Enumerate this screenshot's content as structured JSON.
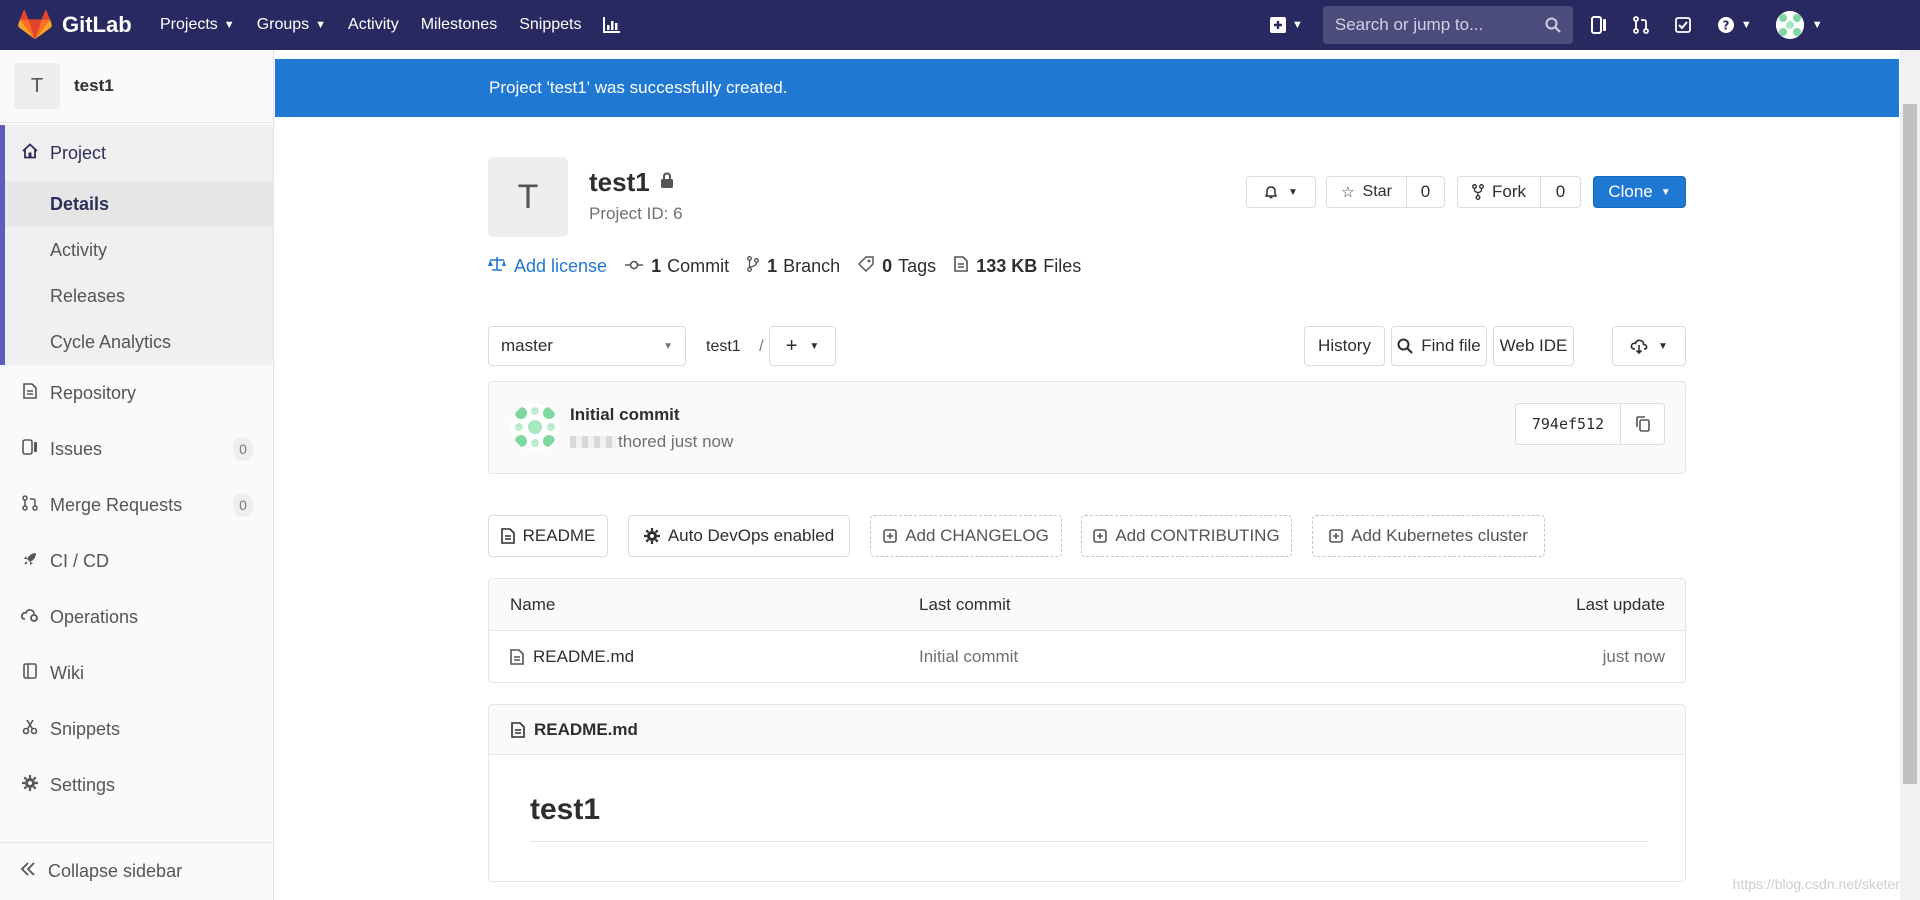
{
  "navbar": {
    "brand": "GitLab",
    "items": [
      {
        "label": "Projects",
        "has_caret": true
      },
      {
        "label": "Groups",
        "has_caret": true
      },
      {
        "label": "Activity",
        "has_caret": false
      },
      {
        "label": "Milestones",
        "has_caret": false
      },
      {
        "label": "Snippets",
        "has_caret": false
      }
    ],
    "search_placeholder": "Search or jump to...",
    "bg_color": "#292961"
  },
  "sidebar": {
    "project_initial": "T",
    "project_name": "test1",
    "project_section": "Project",
    "sub_items": [
      "Details",
      "Activity",
      "Releases",
      "Cycle Analytics"
    ],
    "active_sub": "Details",
    "items": [
      {
        "label": "Repository",
        "icon": "document-icon"
      },
      {
        "label": "Issues",
        "icon": "issues-icon",
        "count": "0"
      },
      {
        "label": "Merge Requests",
        "icon": "merge-request-icon",
        "count": "0"
      },
      {
        "label": "CI / CD",
        "icon": "rocket-icon"
      },
      {
        "label": "Operations",
        "icon": "cloud-gear-icon"
      },
      {
        "label": "Wiki",
        "icon": "book-icon"
      },
      {
        "label": "Snippets",
        "icon": "scissors-icon"
      },
      {
        "label": "Settings",
        "icon": "gear-icon"
      }
    ],
    "collapse_label": "Collapse sidebar"
  },
  "flash": {
    "message": "Project 'test1' was successfully created.",
    "color": "#1f78d1"
  },
  "project": {
    "initial": "T",
    "name": "test1",
    "id_label": "Project ID: 6",
    "star_label": "Star",
    "star_count": "0",
    "fork_label": "Fork",
    "fork_count": "0",
    "clone_label": "Clone",
    "stats": {
      "license": "Add license",
      "commits_count": "1",
      "commits_label": "Commit",
      "branches_count": "1",
      "branches_label": "Branch",
      "tags_count": "0",
      "tags_label": "Tags",
      "files_size": "133 KB",
      "files_label": "Files"
    }
  },
  "repo_toolbar": {
    "branch": "master",
    "path": "test1",
    "separator": "/",
    "history": "History",
    "find_file": "Find file",
    "web_ide": "Web IDE"
  },
  "commit": {
    "title": "Initial commit",
    "meta": "thored just now",
    "sha": "794ef512"
  },
  "action_buttons": [
    {
      "label": "README",
      "icon": "file-icon",
      "dashed": false
    },
    {
      "label": "Auto DevOps enabled",
      "icon": "gear-icon",
      "dashed": false
    },
    {
      "label": "Add CHANGELOG",
      "icon": "plus-square-icon",
      "dashed": true
    },
    {
      "label": "Add CONTRIBUTING",
      "icon": "plus-square-icon",
      "dashed": true
    },
    {
      "label": "Add Kubernetes cluster",
      "icon": "plus-square-icon",
      "dashed": true
    }
  ],
  "file_table": {
    "headers": [
      "Name",
      "Last commit",
      "Last update"
    ],
    "rows": [
      {
        "name": "README.md",
        "last_commit": "Initial commit",
        "last_update": "just now"
      }
    ]
  },
  "readme": {
    "filename": "README.md",
    "heading": "test1"
  },
  "watermark": "https://blog.csdn.net/sketer"
}
